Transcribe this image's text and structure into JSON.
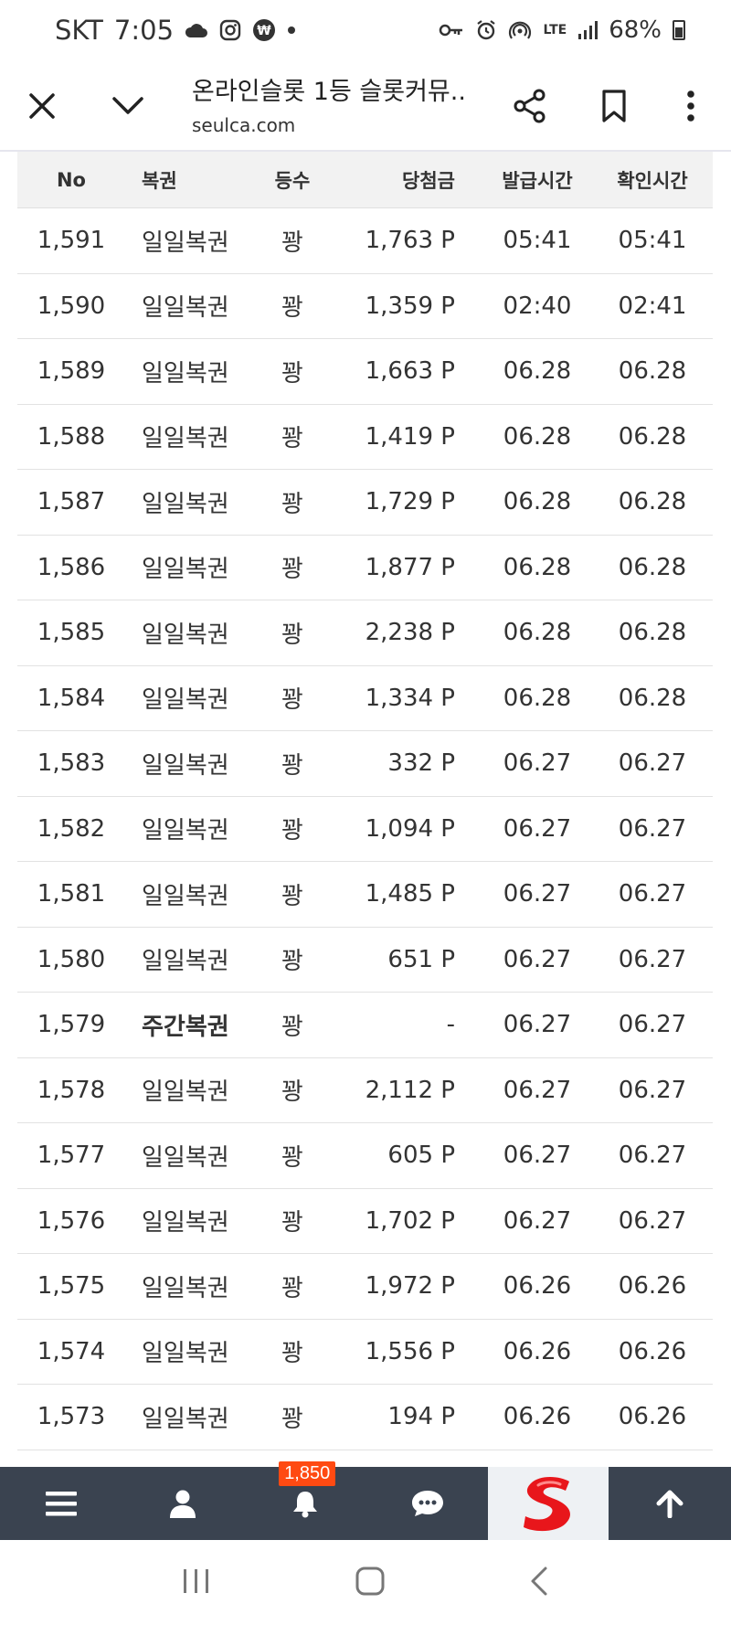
{
  "status_bar": {
    "carrier": "SKT",
    "time": "7:05",
    "network": "LTE",
    "battery": "68%"
  },
  "app_bar": {
    "title": "온라인슬롯 1등 슬롯커뮤...",
    "domain": "seulca.com"
  },
  "table": {
    "headers": {
      "no": "No",
      "lottery": "복권",
      "rank": "등수",
      "prize": "당첨금",
      "issued": "발급시간",
      "checked": "확인시간"
    },
    "rows": [
      {
        "no": "1,591",
        "lottery": "일일복권",
        "rank": "꽝",
        "prize": "1,763 P",
        "issued": "05:41",
        "checked": "05:41"
      },
      {
        "no": "1,590",
        "lottery": "일일복권",
        "rank": "꽝",
        "prize": "1,359 P",
        "issued": "02:40",
        "checked": "02:41"
      },
      {
        "no": "1,589",
        "lottery": "일일복권",
        "rank": "꽝",
        "prize": "1,663 P",
        "issued": "06.28",
        "checked": "06.28"
      },
      {
        "no": "1,588",
        "lottery": "일일복권",
        "rank": "꽝",
        "prize": "1,419 P",
        "issued": "06.28",
        "checked": "06.28"
      },
      {
        "no": "1,587",
        "lottery": "일일복권",
        "rank": "꽝",
        "prize": "1,729 P",
        "issued": "06.28",
        "checked": "06.28"
      },
      {
        "no": "1,586",
        "lottery": "일일복권",
        "rank": "꽝",
        "prize": "1,877 P",
        "issued": "06.28",
        "checked": "06.28"
      },
      {
        "no": "1,585",
        "lottery": "일일복권",
        "rank": "꽝",
        "prize": "2,238 P",
        "issued": "06.28",
        "checked": "06.28"
      },
      {
        "no": "1,584",
        "lottery": "일일복권",
        "rank": "꽝",
        "prize": "1,334 P",
        "issued": "06.28",
        "checked": "06.28"
      },
      {
        "no": "1,583",
        "lottery": "일일복권",
        "rank": "꽝",
        "prize": "332 P",
        "issued": "06.27",
        "checked": "06.27"
      },
      {
        "no": "1,582",
        "lottery": "일일복권",
        "rank": "꽝",
        "prize": "1,094 P",
        "issued": "06.27",
        "checked": "06.27"
      },
      {
        "no": "1,581",
        "lottery": "일일복권",
        "rank": "꽝",
        "prize": "1,485 P",
        "issued": "06.27",
        "checked": "06.27"
      },
      {
        "no": "1,580",
        "lottery": "일일복권",
        "rank": "꽝",
        "prize": "651 P",
        "issued": "06.27",
        "checked": "06.27"
      },
      {
        "no": "1,579",
        "lottery": "주간복권",
        "rank": "꽝",
        "prize": "-",
        "issued": "06.27",
        "checked": "06.27",
        "bold": true
      },
      {
        "no": "1,578",
        "lottery": "일일복권",
        "rank": "꽝",
        "prize": "2,112 P",
        "issued": "06.27",
        "checked": "06.27"
      },
      {
        "no": "1,577",
        "lottery": "일일복권",
        "rank": "꽝",
        "prize": "605 P",
        "issued": "06.27",
        "checked": "06.27"
      },
      {
        "no": "1,576",
        "lottery": "일일복권",
        "rank": "꽝",
        "prize": "1,702 P",
        "issued": "06.27",
        "checked": "06.27"
      },
      {
        "no": "1,575",
        "lottery": "일일복권",
        "rank": "꽝",
        "prize": "1,972 P",
        "issued": "06.26",
        "checked": "06.26"
      },
      {
        "no": "1,574",
        "lottery": "일일복권",
        "rank": "꽝",
        "prize": "1,556 P",
        "issued": "06.26",
        "checked": "06.26"
      },
      {
        "no": "1,573",
        "lottery": "일일복권",
        "rank": "꽝",
        "prize": "194 P",
        "issued": "06.26",
        "checked": "06.26"
      }
    ]
  },
  "bottom_nav": {
    "notification_count": "1,850",
    "items": [
      "menu-icon",
      "user-icon",
      "bell-icon",
      "chat-icon",
      "site-logo",
      "arrow-up-icon"
    ]
  },
  "colors": {
    "nav_bg": "#3a4350",
    "badge_bg": "#ff4a12",
    "logo_red": "#e8161b",
    "header_bg": "#f2f2f2"
  }
}
